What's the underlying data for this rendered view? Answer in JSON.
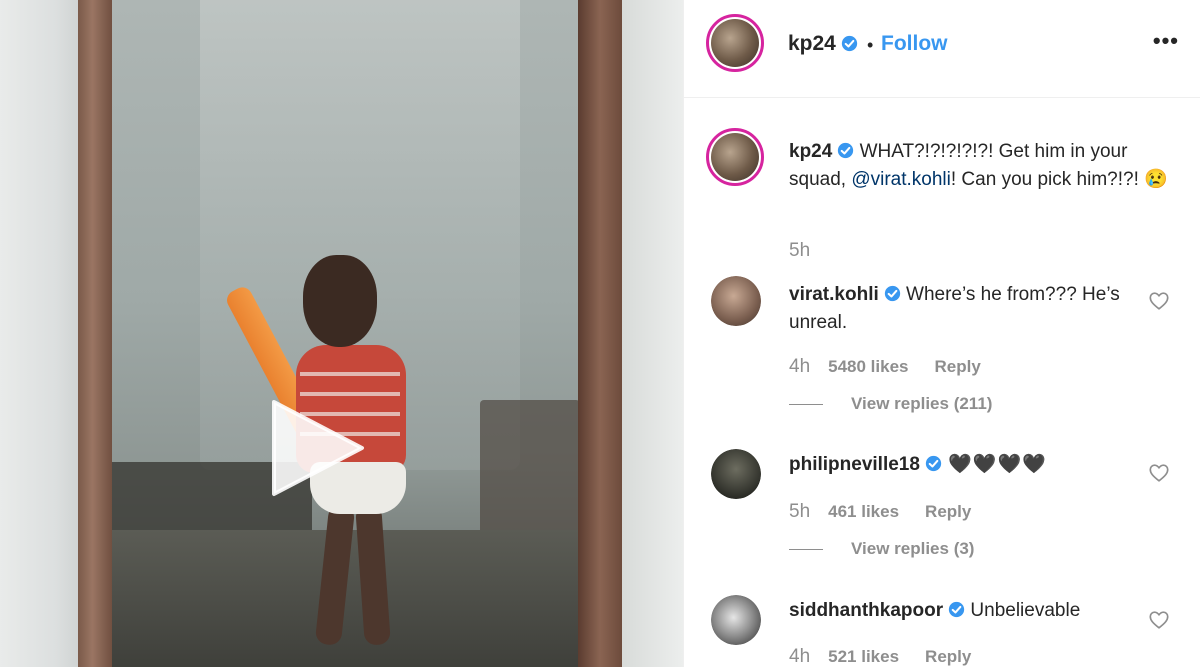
{
  "post": {
    "author": "kp24",
    "follow_label": "Follow",
    "separator": "•",
    "more_label": "•••",
    "caption_user": "kp24",
    "caption_text_1": " WHAT?!?!?!?!?! Get him in your squad, ",
    "caption_mention": "@virat.kohli",
    "caption_text_2": "! Can you pick him?!?! 😢",
    "caption_time": "5h"
  },
  "comments": [
    {
      "user": "virat.kohli",
      "text": " Where’s he from??? He’s unreal.",
      "time": "4h",
      "likes": "5480 likes",
      "reply": "Reply",
      "view_replies": "View replies (211)"
    },
    {
      "user": "philipneville18",
      "text": " 🖤🖤🖤🖤",
      "time": "5h",
      "likes": "461 likes",
      "reply": "Reply",
      "view_replies": "View replies (3)"
    },
    {
      "user": "siddhanthkapoor",
      "text": " Unbelievable",
      "time": "4h",
      "likes": "521 likes",
      "reply": "Reply"
    }
  ],
  "colors": {
    "accent": "#3897f0",
    "verified": "#3897f0",
    "muted": "#8e8e8e",
    "mention": "#003569"
  },
  "icons": {
    "verified": "verified-badge-icon",
    "like": "heart-outline-icon",
    "play": "play-icon",
    "more": "more-options-icon"
  }
}
